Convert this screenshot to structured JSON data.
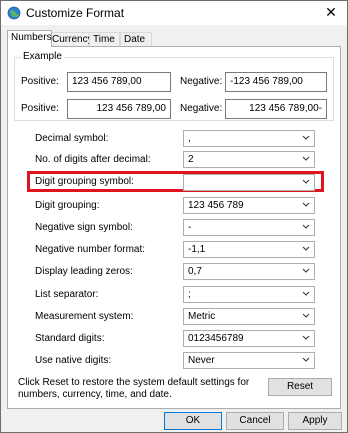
{
  "window": {
    "title": "Customize Format"
  },
  "tabs": [
    {
      "label": "Numbers"
    },
    {
      "label": "Currency"
    },
    {
      "label": "Time"
    },
    {
      "label": "Date"
    }
  ],
  "example": {
    "legend": "Example",
    "positive_label": "Positive:",
    "negative_label": "Negative:",
    "row1": {
      "positive": "123 456 789,00",
      "negative": "-123 456 789,00"
    },
    "row2": {
      "positive": "123 456 789,00",
      "negative": "123 456 789,00-"
    }
  },
  "settings": [
    {
      "label": "Decimal symbol:",
      "value": ","
    },
    {
      "label": "No. of digits after decimal:",
      "value": "2"
    },
    {
      "label": "Digit grouping symbol:",
      "value": ""
    },
    {
      "label": "Digit grouping:",
      "value": "123 456 789"
    },
    {
      "label": "Negative sign symbol:",
      "value": "-"
    },
    {
      "label": "Negative number format:",
      "value": "-1,1"
    },
    {
      "label": "Display leading zeros:",
      "value": "0,7"
    },
    {
      "label": "List separator:",
      "value": ";"
    },
    {
      "label": "Measurement system:",
      "value": "Metric"
    },
    {
      "label": "Standard digits:",
      "value": "0123456789"
    },
    {
      "label": "Use native digits:",
      "value": "Never"
    }
  ],
  "reset": {
    "text": "Click Reset to restore the system default settings for numbers, currency, time, and date.",
    "button": "Reset"
  },
  "footer": {
    "ok": "OK",
    "cancel": "Cancel",
    "apply": "Apply"
  },
  "colors": {
    "highlight": "#e0141e",
    "default_button_border": "#0078d7"
  }
}
